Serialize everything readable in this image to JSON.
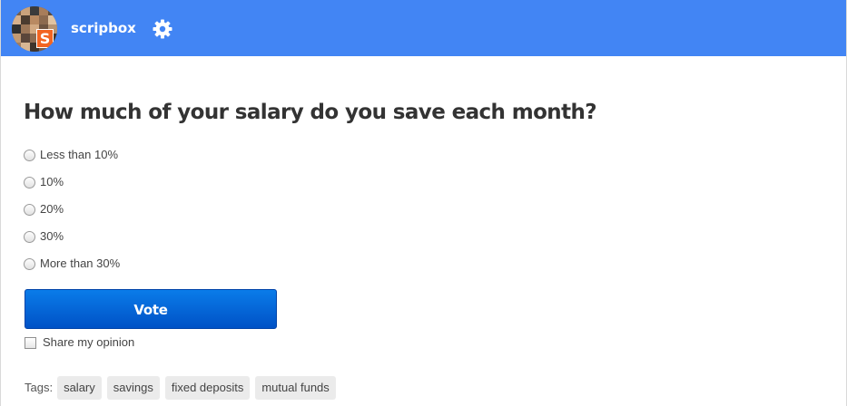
{
  "header": {
    "brand": "scripbox",
    "avatar_logo_letter": "S",
    "avatar_logo_color": "#f26522",
    "gear_icon": "gear-icon",
    "background_color": "#4285f4"
  },
  "poll": {
    "question": "How much of your salary do you save each month?",
    "options": [
      {
        "label": "Less than 10%",
        "selected": false
      },
      {
        "label": "10%",
        "selected": false
      },
      {
        "label": "20%",
        "selected": false
      },
      {
        "label": "30%",
        "selected": false
      },
      {
        "label": "More than 30%",
        "selected": false
      }
    ],
    "vote_label": "Vote",
    "share_label": "Share my opinion",
    "share_checked": false
  },
  "tags": {
    "label": "Tags:",
    "items": [
      "salary",
      "savings",
      "fixed deposits",
      "mutual funds"
    ]
  }
}
